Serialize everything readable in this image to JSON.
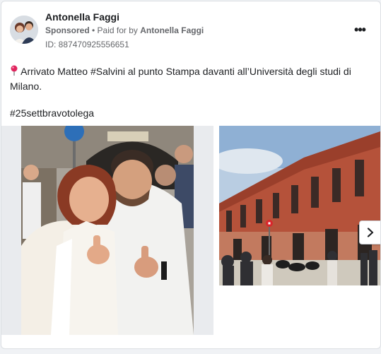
{
  "post": {
    "author": "Antonella Faggi",
    "sponsored_label": "Sponsored",
    "separator": " • ",
    "paid_for_prefix": "Paid for by ",
    "paid_for_name": "Antonella Faggi",
    "ad_id": "ID: 887470925556651",
    "more_label": "•••",
    "text": "Arrivato Matteo #Salvini al punto Stampa davanti all’Università degli studi di Milano.",
    "hashtag": "#25settbravotolega"
  },
  "icons": {
    "options": "more-options-icon",
    "pin": "pushpin-icon",
    "next": "chevron-right-icon"
  },
  "colors": {
    "text": "#1c1e21",
    "secondary": "#65676b",
    "pin": "#e0245e"
  }
}
